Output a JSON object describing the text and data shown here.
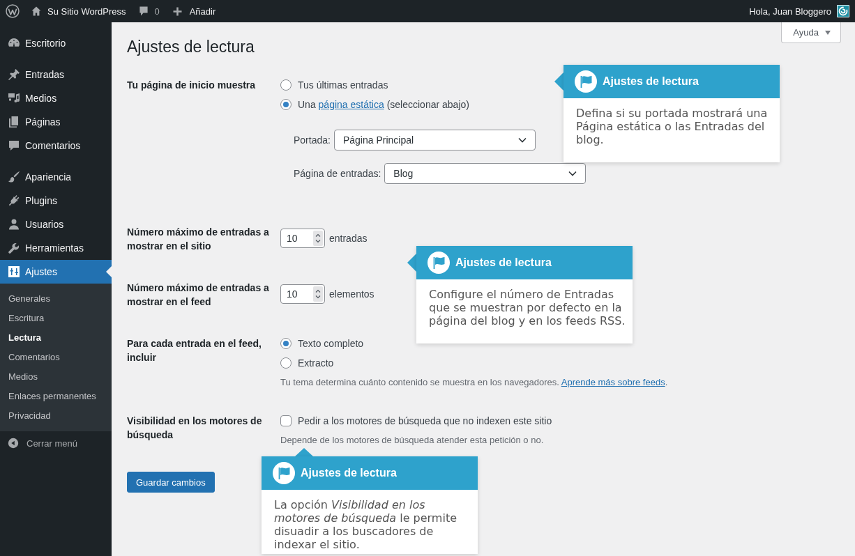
{
  "admin_bar": {
    "site_name": "Su Sitio WordPress",
    "comments_count": "0",
    "new_label": "Añadir",
    "greeting": "Hola, Juan Bloggero"
  },
  "sidebar": {
    "groups": [
      {
        "items": [
          {
            "label": "Escritorio",
            "selected": false
          }
        ]
      },
      {
        "items": [
          {
            "label": "Entradas",
            "selected": false
          },
          {
            "label": "Medios",
            "selected": false
          },
          {
            "label": "Páginas",
            "selected": false
          },
          {
            "label": "Comentarios",
            "selected": false
          }
        ]
      },
      {
        "items": [
          {
            "label": "Apariencia",
            "selected": false
          },
          {
            "label": "Plugins",
            "selected": false
          },
          {
            "label": "Usuarios",
            "selected": false
          },
          {
            "label": "Herramientas",
            "selected": false
          },
          {
            "label": "Ajustes",
            "selected": true,
            "children": [
              {
                "label": "Generales",
                "selected": false
              },
              {
                "label": "Escritura",
                "selected": false
              },
              {
                "label": "Lectura",
                "selected": true
              },
              {
                "label": "Comentarios",
                "selected": false
              },
              {
                "label": "Medios",
                "selected": false
              },
              {
                "label": "Enlaces permanentes",
                "selected": false
              },
              {
                "label": "Privacidad",
                "selected": false
              }
            ]
          }
        ]
      }
    ],
    "collapse_label": "Cerrar menú"
  },
  "page_title": "Ajustes de lectura",
  "help_button": "Ayuda",
  "settings": [
    {
      "kind": "radio_group",
      "label": "Tu página de inicio muestra",
      "options": [
        {
          "text": "Tus últimas entradas",
          "selected": false
        },
        {
          "text": "Una",
          "link": "página estática",
          "after": "(seleccionar abajo)",
          "selected": true
        }
      ],
      "selects": [
        {
          "label": "Portada:",
          "value": "Página Principal"
        },
        {
          "label": "Página de entradas:",
          "value": "Blog"
        }
      ]
    },
    {
      "kind": "number",
      "label": "Número máximo de entradas a mostrar en el sitio",
      "value": "10",
      "unit": "entradas"
    },
    {
      "kind": "number",
      "label": "Número máximo de entradas a mostrar en el feed",
      "value": "10",
      "unit": "elementos"
    },
    {
      "kind": "radio_group",
      "label": "Para cada entrada en el feed, incluir",
      "options": [
        {
          "text": "Texto completo",
          "selected": true
        },
        {
          "text": "Extracto",
          "selected": false
        }
      ],
      "description": "Tu tema determina cuánto contenido se muestra en los navegadores.",
      "description_link": "Aprende más sobre feeds",
      "description_end": "."
    },
    {
      "kind": "checkbox",
      "label": "Visibilidad en los motores de búsqueda",
      "text": "Pedir a los motores de búsqueda que no indexen este sitio",
      "checked": false,
      "description": "Depende de los motores de búsqueda atender esta petición o no."
    }
  ],
  "save_button": "Guardar cambios",
  "pointers": [
    {
      "kind": "left",
      "title": "Ajustes de lectura",
      "body": "Defina si su portada mostrará una Página estática o las Entradas del blog."
    },
    {
      "kind": "left",
      "title": "Ajustes de lectura",
      "body": "Configure el número de Entradas que se muestran por defecto en la página del blog y en los feeds RSS."
    },
    {
      "kind": "top",
      "title": "Ajustes de lectura",
      "body": "La opción *Visibilidad en los motores de búsqueda* le permite disuadir a los buscadores de indexar el sitio."
    }
  ]
}
